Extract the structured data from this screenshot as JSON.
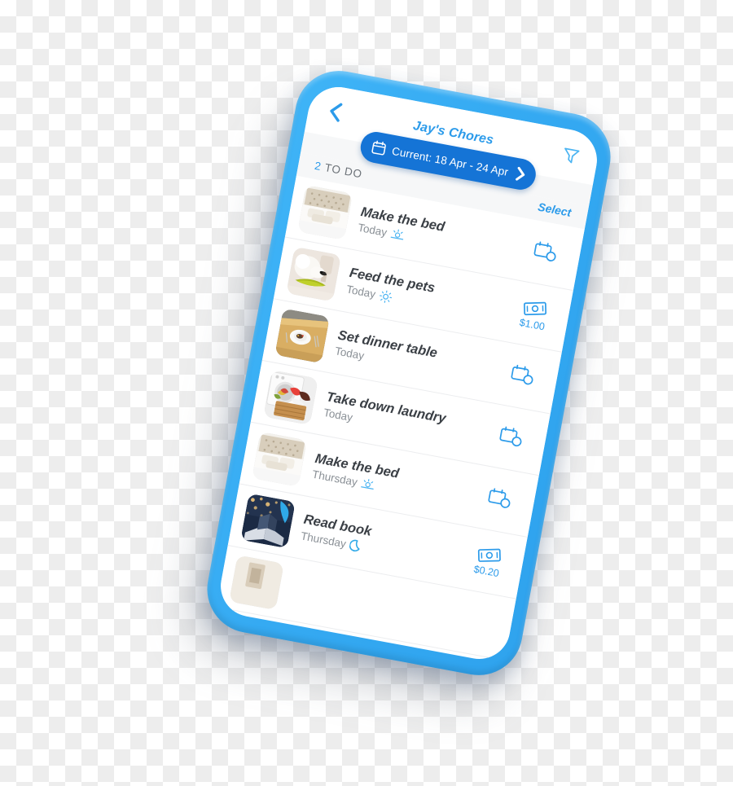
{
  "app": {
    "background": "transparency-checkerboard",
    "frame_color": "#35AAF2",
    "accent_color": "#2C9BEA",
    "pill_color": "#1574D6"
  },
  "navbar": {
    "back_label": "Back",
    "title": "Jay's Chores",
    "back_icon": "chevron-left-icon",
    "filter_icon": "funnel-filter-icon"
  },
  "date_selector": {
    "calendar_icon": "calendar-icon",
    "label": "Current: 18 Apr - 24 Apr",
    "next_icon": "chevron-right-icon"
  },
  "list_header": {
    "count": "2",
    "label": "TO DO",
    "select_label": "Select"
  },
  "chores": [
    {
      "title": "Make the bed",
      "day": "Today",
      "time_icon": "sunrise-icon",
      "action_icon": "calendar-clock-icon",
      "reward": "",
      "thumb": "bed-tufted-headboard"
    },
    {
      "title": "Feed the pets",
      "day": "Today",
      "time_icon": "sun-icon",
      "action_icon": "banknote-icon",
      "reward": "$1.00",
      "thumb": "dog-eating-green-bowl"
    },
    {
      "title": "Set dinner table",
      "day": "Today",
      "time_icon": "",
      "action_icon": "calendar-clock-icon",
      "reward": "",
      "thumb": "dinner-table-plate"
    },
    {
      "title": "Take down laundry",
      "day": "Today",
      "time_icon": "",
      "action_icon": "calendar-clock-icon",
      "reward": "",
      "thumb": "laundry-basket-washer"
    },
    {
      "title": "Make the bed",
      "day": "Thursday",
      "time_icon": "sunrise-icon",
      "action_icon": "calendar-clock-icon",
      "reward": "",
      "thumb": "bed-tufted-headboard"
    },
    {
      "title": "Read book",
      "day": "Thursday",
      "time_icon": "moon-icon",
      "action_icon": "banknote-icon",
      "reward": "$0.20",
      "thumb": "open-book-bokeh-lights"
    }
  ]
}
